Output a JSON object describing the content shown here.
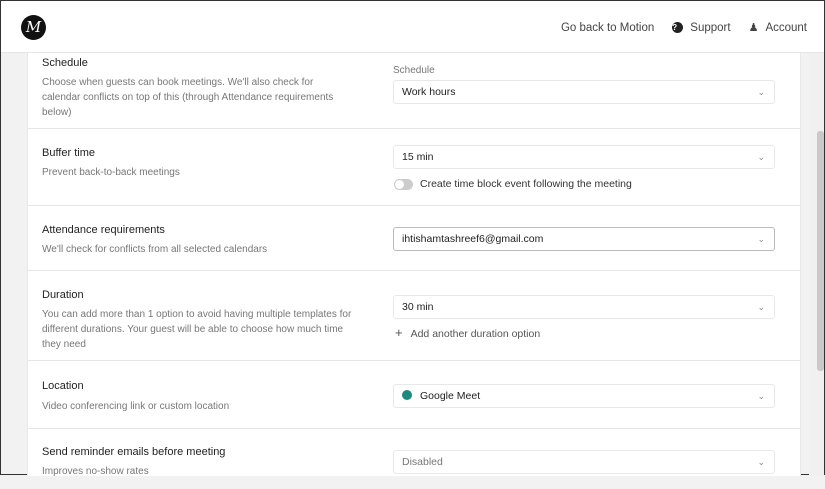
{
  "header": {
    "logo": "M",
    "go_back": "Go back to Motion",
    "support": "Support",
    "account": "Account"
  },
  "sections": {
    "schedule": {
      "title": "Schedule",
      "desc": "Choose when guests can book meetings. We'll also check for calendar conflicts on top of this (through Attendance requirements below)",
      "field_label": "Schedule",
      "value": "Work hours"
    },
    "buffer": {
      "title": "Buffer time",
      "desc": "Prevent back-to-back meetings",
      "value": "15 min",
      "toggle_label": "Create time block event following the meeting",
      "toggle_on": false
    },
    "attendance": {
      "title": "Attendance requirements",
      "desc": "We'll check for conflicts from all selected calendars",
      "value": "ihtishamtashreef6@gmail.com"
    },
    "duration": {
      "title": "Duration",
      "desc": "You can add more than 1 option to avoid having multiple templates for different durations. Your guest will be able to choose how much time they need",
      "value": "30 min",
      "add_option": "Add another duration option"
    },
    "location": {
      "title": "Location",
      "desc": "Video conferencing link or custom location",
      "value": "Google Meet"
    },
    "reminder": {
      "title": "Send reminder emails before meeting",
      "desc": "Improves no-show rates",
      "value": "Disabled"
    }
  }
}
